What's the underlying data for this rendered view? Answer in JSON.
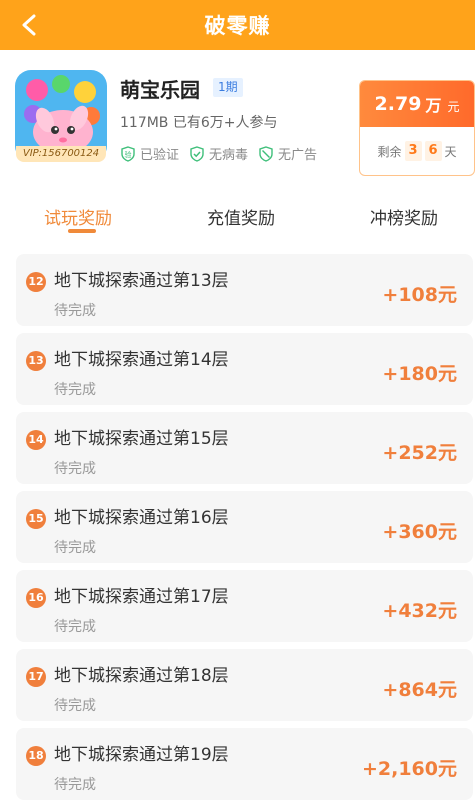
{
  "header": {
    "title": "破零赚",
    "back_icon": "chevron-left-icon"
  },
  "app": {
    "name": "萌宝乐园",
    "issue": "1期",
    "vip": "VIP:156700124",
    "meta": "117MB 已有6万+人参与",
    "badges": [
      {
        "label": "已验证",
        "icon": "verified-icon"
      },
      {
        "label": "无病毒",
        "icon": "shield-check-icon"
      },
      {
        "label": "无广告",
        "icon": "no-ads-icon"
      }
    ]
  },
  "reward_card": {
    "amount": "2.79",
    "unit": "万",
    "currency": "元",
    "remaining_label": "剩余",
    "days_digit1": "3",
    "days_digit2": "6",
    "days_label": "天"
  },
  "tabs": [
    {
      "label": "试玩奖励",
      "active": true
    },
    {
      "label": "充值奖励",
      "active": false
    },
    {
      "label": "冲榜奖励",
      "active": false
    }
  ],
  "tasks": [
    {
      "num": "12",
      "title": "地下城探索通过第13层",
      "status": "待完成",
      "reward": "+108元"
    },
    {
      "num": "13",
      "title": "地下城探索通过第14层",
      "status": "待完成",
      "reward": "+180元"
    },
    {
      "num": "14",
      "title": "地下城探索通过第15层",
      "status": "待完成",
      "reward": "+252元"
    },
    {
      "num": "15",
      "title": "地下城探索通过第16层",
      "status": "待完成",
      "reward": "+360元"
    },
    {
      "num": "16",
      "title": "地下城探索通过第17层",
      "status": "待完成",
      "reward": "+432元"
    },
    {
      "num": "17",
      "title": "地下城探索通过第18层",
      "status": "待完成",
      "reward": "+864元"
    },
    {
      "num": "18",
      "title": "地下城探索通过第19层",
      "status": "待完成",
      "reward": "+2,160元"
    }
  ],
  "colors": {
    "header": "#ffa31a",
    "accent": "#f07f3c",
    "badge": "#3fbf7a"
  }
}
